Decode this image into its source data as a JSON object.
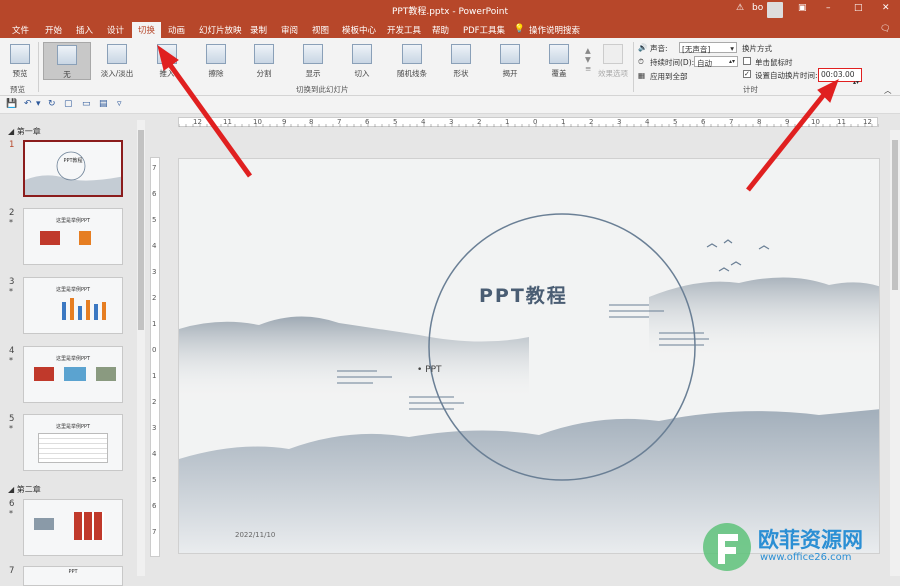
{
  "window": {
    "title": "PPT教程.pptx - PowerPoint",
    "user": "bo",
    "warn_icon": "warning-icon",
    "controls": [
      "–",
      "□",
      "✕"
    ]
  },
  "tabs": [
    {
      "label": "文件",
      "active": false
    },
    {
      "label": "开始",
      "active": false
    },
    {
      "label": "插入",
      "active": false
    },
    {
      "label": "设计",
      "active": false
    },
    {
      "label": "切换",
      "active": true
    },
    {
      "label": "动画",
      "active": false
    },
    {
      "label": "幻灯片放映",
      "active": false
    },
    {
      "label": "录制",
      "active": false
    },
    {
      "label": "审阅",
      "active": false
    },
    {
      "label": "视图",
      "active": false
    },
    {
      "label": "模板中心",
      "active": false
    },
    {
      "label": "开发工具",
      "active": false
    },
    {
      "label": "帮助",
      "active": false
    },
    {
      "label": "PDF工具集",
      "active": false
    },
    {
      "label": "操作说明搜索",
      "active": false
    }
  ],
  "ribbon": {
    "preview": {
      "label": "预览",
      "group": "预览"
    },
    "transitions": [
      {
        "label": "无",
        "selected": true
      },
      {
        "label": "淡入/淡出"
      },
      {
        "label": "推入"
      },
      {
        "label": "擦除"
      },
      {
        "label": "分割"
      },
      {
        "label": "显示"
      },
      {
        "label": "切入"
      },
      {
        "label": "随机线条"
      },
      {
        "label": "形状"
      },
      {
        "label": "揭开"
      },
      {
        "label": "覆盖"
      }
    ],
    "effect_options": "效果选项",
    "group_transitions": "切换到此幻灯片",
    "timing": {
      "sound_label": "声音:",
      "sound_value": "[无声音]",
      "duration_label": "持续时间(D):",
      "duration_value": "自动",
      "apply_all": "应用到全部",
      "advance_title": "换片方式",
      "on_click": "单击鼠标时",
      "on_click_checked": false,
      "after_label": "设置自动换片时间:",
      "after_checked": true,
      "after_value": "00:03.00",
      "group": "计时"
    }
  },
  "thumbnails": {
    "sections": [
      {
        "label": "第一章"
      },
      {
        "label": "第二章"
      }
    ],
    "slides": [
      {
        "num": "1",
        "star": false,
        "title": "PPT教程"
      },
      {
        "num": "2",
        "star": true,
        "title": "这里是举例PPT"
      },
      {
        "num": "3",
        "star": true,
        "title": "这里是举例PPT"
      },
      {
        "num": "4",
        "star": true,
        "title": "这里是举例PPT"
      },
      {
        "num": "5",
        "star": true,
        "title": "这里是举例PPT"
      },
      {
        "num": "6",
        "star": true,
        "title": ""
      },
      {
        "num": "7",
        "star": false,
        "title": "PPT"
      }
    ]
  },
  "slide": {
    "title": "PPT教程",
    "bullet": "• PPT",
    "date": "2022/11/10"
  },
  "watermark": {
    "text": "欧菲资源网",
    "url": "www.office26.com"
  },
  "colors": {
    "accent": "#b7472a",
    "arrow": "#e02020",
    "ink": "#6a7f95"
  }
}
